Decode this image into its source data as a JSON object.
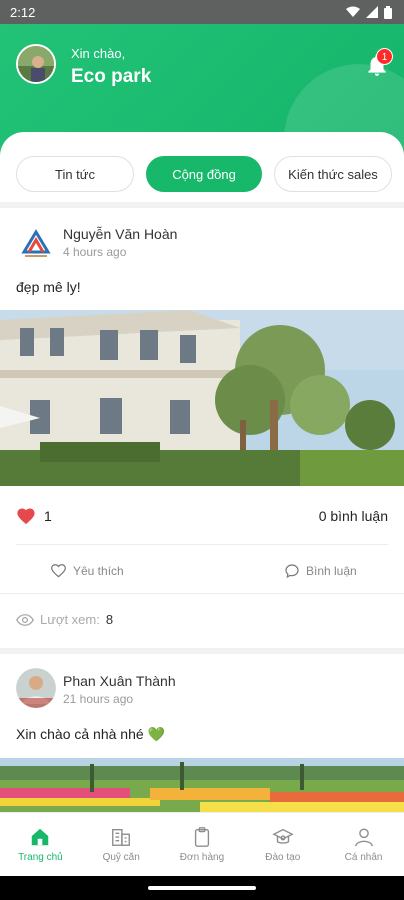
{
  "status_bar": {
    "time": "2:12"
  },
  "header": {
    "greeting": "Xin chào,",
    "username": "Eco park",
    "notification_count": "1"
  },
  "tabs": [
    {
      "label": "Tin tức"
    },
    {
      "label": "Cộng đồng",
      "active": true
    },
    {
      "label": "Kiến thức sales"
    }
  ],
  "posts": [
    {
      "author": "Nguyễn Văn Hoàn",
      "time": "4 hours ago",
      "text": "đẹp mê ly!",
      "likes": "1",
      "comments": "0 bình luận",
      "like_label": "Yêu thích",
      "comment_label": "Bình luận",
      "views_label": "Lượt xem:",
      "views": "8"
    },
    {
      "author": "Phan Xuân Thành",
      "time": "21 hours ago",
      "text": "Xin chào cả nhà nhé 💚"
    }
  ],
  "bottom_nav": [
    {
      "label": "Trang chủ",
      "icon": "home-icon",
      "active": true
    },
    {
      "label": "Quỹ căn",
      "icon": "building-icon"
    },
    {
      "label": "Đơn hàng",
      "icon": "clipboard-icon"
    },
    {
      "label": "Đào tạo",
      "icon": "graduation-cap-icon"
    },
    {
      "label": "Cá nhân",
      "icon": "person-icon"
    }
  ],
  "colors": {
    "brand": "#17b86a",
    "badge": "#ff2b2b",
    "heart": "#e5484d"
  }
}
